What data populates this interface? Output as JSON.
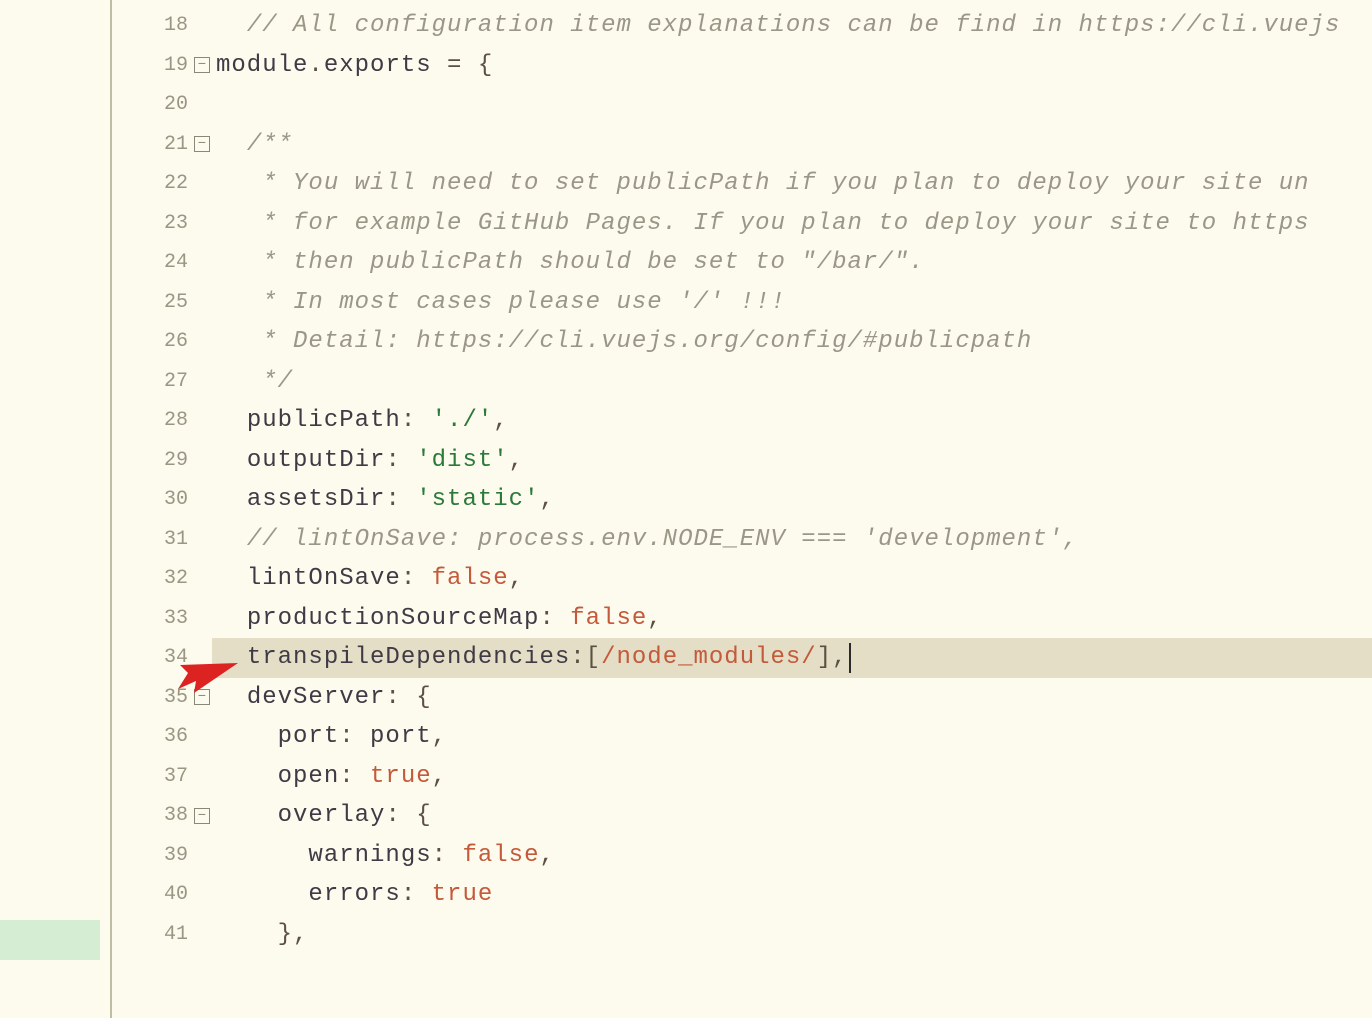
{
  "lines": [
    {
      "n": 18,
      "fold": null,
      "tokens": [
        [
          "  ",
          "c-kw"
        ],
        [
          "// All configuration item explanations can be find in https://cli.vuejs",
          "c-comment"
        ]
      ]
    },
    {
      "n": 19,
      "fold": "minus",
      "tokens": [
        [
          "module",
          "c-kw"
        ],
        [
          ".",
          "c-punc"
        ],
        [
          "exports",
          "c-kw"
        ],
        [
          " = ",
          "c-punc"
        ],
        [
          "{",
          "c-punc"
        ]
      ]
    },
    {
      "n": 20,
      "fold": null,
      "tokens": []
    },
    {
      "n": 21,
      "fold": "minus",
      "tokens": [
        [
          "  ",
          "c-kw"
        ],
        [
          "/**",
          "c-comment"
        ]
      ]
    },
    {
      "n": 22,
      "fold": null,
      "tokens": [
        [
          "   ",
          "c-kw"
        ],
        [
          "* You will need to set publicPath if you plan to deploy your site un",
          "c-comment"
        ]
      ]
    },
    {
      "n": 23,
      "fold": null,
      "tokens": [
        [
          "   ",
          "c-kw"
        ],
        [
          "* for example GitHub Pages. If you plan to deploy your site to https",
          "c-comment"
        ]
      ]
    },
    {
      "n": 24,
      "fold": null,
      "tokens": [
        [
          "   ",
          "c-kw"
        ],
        [
          "* then publicPath should be set to \"/bar/\".",
          "c-comment"
        ]
      ]
    },
    {
      "n": 25,
      "fold": null,
      "tokens": [
        [
          "   ",
          "c-kw"
        ],
        [
          "* In most cases please use '/' !!!",
          "c-comment"
        ]
      ]
    },
    {
      "n": 26,
      "fold": null,
      "tokens": [
        [
          "   ",
          "c-kw"
        ],
        [
          "* Detail: https://cli.vuejs.org/config/#publicpath",
          "c-comment"
        ]
      ]
    },
    {
      "n": 27,
      "fold": null,
      "tokens": [
        [
          "   ",
          "c-kw"
        ],
        [
          "*/",
          "c-comment"
        ]
      ]
    },
    {
      "n": 28,
      "fold": null,
      "tokens": [
        [
          "  ",
          "c-kw"
        ],
        [
          "publicPath",
          "c-prop"
        ],
        [
          ": ",
          "c-punc"
        ],
        [
          "'./'",
          "c-string"
        ],
        [
          ",",
          "c-punc"
        ]
      ]
    },
    {
      "n": 29,
      "fold": null,
      "tokens": [
        [
          "  ",
          "c-kw"
        ],
        [
          "outputDir",
          "c-prop"
        ],
        [
          ": ",
          "c-punc"
        ],
        [
          "'dist'",
          "c-string"
        ],
        [
          ",",
          "c-punc"
        ]
      ]
    },
    {
      "n": 30,
      "fold": null,
      "tokens": [
        [
          "  ",
          "c-kw"
        ],
        [
          "assetsDir",
          "c-prop"
        ],
        [
          ": ",
          "c-punc"
        ],
        [
          "'static'",
          "c-string"
        ],
        [
          ",",
          "c-punc"
        ]
      ]
    },
    {
      "n": 31,
      "fold": null,
      "tokens": [
        [
          "  ",
          "c-kw"
        ],
        [
          "// lintOnSave: process.env.NODE_ENV === 'development',",
          "c-comment"
        ]
      ]
    },
    {
      "n": 32,
      "fold": null,
      "tokens": [
        [
          "  ",
          "c-kw"
        ],
        [
          "lintOnSave",
          "c-prop"
        ],
        [
          ": ",
          "c-punc"
        ],
        [
          "false",
          "c-bool"
        ],
        [
          ",",
          "c-punc"
        ]
      ]
    },
    {
      "n": 33,
      "fold": null,
      "tokens": [
        [
          "  ",
          "c-kw"
        ],
        [
          "productionSourceMap",
          "c-prop"
        ],
        [
          ": ",
          "c-punc"
        ],
        [
          "false",
          "c-bool"
        ],
        [
          ",",
          "c-punc"
        ]
      ]
    },
    {
      "n": 34,
      "fold": null,
      "hl": true,
      "cursor": true,
      "tokens": [
        [
          "  ",
          "c-kw"
        ],
        [
          "transpileDependencies",
          "c-prop"
        ],
        [
          ":",
          "c-punc"
        ],
        [
          "[",
          "c-punc"
        ],
        [
          "/node_modules/",
          "c-regex"
        ],
        [
          "]",
          "c-punc"
        ],
        [
          ",",
          "c-punc"
        ]
      ]
    },
    {
      "n": 35,
      "fold": "minus",
      "tokens": [
        [
          "  ",
          "c-kw"
        ],
        [
          "devServer",
          "c-prop"
        ],
        [
          ": ",
          "c-punc"
        ],
        [
          "{",
          "c-punc"
        ]
      ]
    },
    {
      "n": 36,
      "fold": null,
      "tokens": [
        [
          "    ",
          "c-kw"
        ],
        [
          "port",
          "c-prop"
        ],
        [
          ": ",
          "c-punc"
        ],
        [
          "port",
          "c-ident"
        ],
        [
          ",",
          "c-punc"
        ]
      ]
    },
    {
      "n": 37,
      "fold": null,
      "tokens": [
        [
          "    ",
          "c-kw"
        ],
        [
          "open",
          "c-prop"
        ],
        [
          ": ",
          "c-punc"
        ],
        [
          "true",
          "c-bool"
        ],
        [
          ",",
          "c-punc"
        ]
      ]
    },
    {
      "n": 38,
      "fold": "minus",
      "tokens": [
        [
          "    ",
          "c-kw"
        ],
        [
          "overlay",
          "c-prop"
        ],
        [
          ": ",
          "c-punc"
        ],
        [
          "{",
          "c-punc"
        ]
      ]
    },
    {
      "n": 39,
      "fold": null,
      "tokens": [
        [
          "      ",
          "c-kw"
        ],
        [
          "warnings",
          "c-prop"
        ],
        [
          ": ",
          "c-punc"
        ],
        [
          "false",
          "c-bool"
        ],
        [
          ",",
          "c-punc"
        ]
      ]
    },
    {
      "n": 40,
      "fold": null,
      "tokens": [
        [
          "      ",
          "c-kw"
        ],
        [
          "errors",
          "c-prop"
        ],
        [
          ": ",
          "c-punc"
        ],
        [
          "true",
          "c-bool"
        ]
      ]
    },
    {
      "n": 41,
      "fold": null,
      "tokens": [
        [
          "    ",
          "c-kw"
        ],
        [
          "},",
          "c-punc"
        ]
      ]
    }
  ],
  "fold_glyph": {
    "minus": "⊟"
  }
}
